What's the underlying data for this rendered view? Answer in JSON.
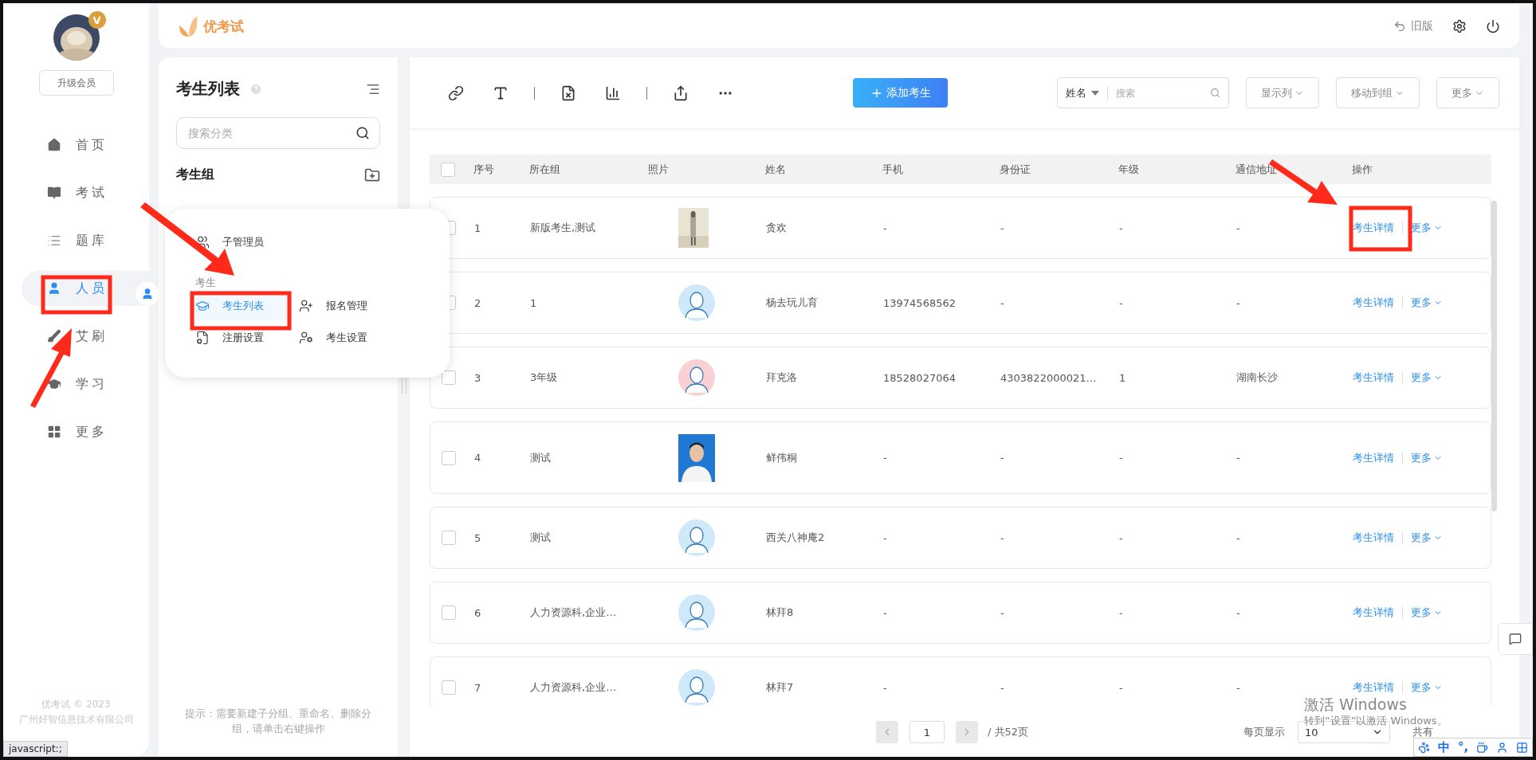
{
  "sidebar": {
    "badge": "V",
    "upgrade": "升级会员",
    "items": [
      {
        "label": "首页",
        "kind": "home",
        "selected": false
      },
      {
        "label": "考试",
        "kind": "exam",
        "selected": false
      },
      {
        "label": "题库",
        "kind": "bank",
        "selected": false
      },
      {
        "label": "人员",
        "kind": "people",
        "selected": true
      },
      {
        "label": "艾刷",
        "kind": "brush",
        "selected": false
      },
      {
        "label": "学习",
        "kind": "study",
        "selected": false
      },
      {
        "label": "更多",
        "kind": "more",
        "selected": false
      }
    ],
    "footer": [
      "优考试 © 2023",
      "广州好智信息技术有限公司"
    ]
  },
  "status_link": "javascript:;",
  "header": {
    "logo": "优考试",
    "old_version": "旧版"
  },
  "group_panel": {
    "title": "考生列表",
    "search_placeholder": "搜索分类",
    "section": "考生组",
    "hint": "提示：需要新建子分组、重命名、删除分组，请单击右键操作"
  },
  "popup": {
    "admin": {
      "label": "子管理员",
      "kind": "admin",
      "selected": false
    },
    "section": "考生",
    "items": [
      {
        "label": "考生列表",
        "kind": "list",
        "selected": true
      },
      {
        "label": "报名管理",
        "kind": "signup",
        "selected": false
      },
      {
        "label": "注册设置",
        "kind": "register",
        "selected": false
      },
      {
        "label": "考生设置",
        "kind": "settings",
        "selected": false
      }
    ]
  },
  "toolbar": {
    "add": "添加考生",
    "field": "姓名",
    "search_placeholder": "搜索",
    "buttons": [
      "显示列",
      "移动到组",
      "更多"
    ]
  },
  "table": {
    "header_checked": false,
    "columns": [
      "序号",
      "所在组",
      "照片",
      "姓名",
      "手机",
      "身份证",
      "年级",
      "通信地址",
      "操作"
    ],
    "rows": [
      {
        "checked": false,
        "index": "1",
        "group": "新版考生,测试",
        "name": "贪欢",
        "phone": "-",
        "id_card": "-",
        "grade": "-",
        "address": "-",
        "detail": "考生详情",
        "more": "更多"
      },
      {
        "checked": false,
        "index": "2",
        "group": "1",
        "photo": {
          "kind": "avatar",
          "color": "#cfe9fb"
        },
        "name": "杨去玩儿育",
        "phone": "13974568562",
        "id_card": "-",
        "grade": "-",
        "address": "-",
        "detail": "考生详情",
        "more": "更多"
      },
      {
        "checked": false,
        "index": "3",
        "group": "3年级",
        "photo": {
          "kind": "avatar",
          "color": "#f9d0d3"
        },
        "name": "拜克洛",
        "phone": "18528027064",
        "id_card": "4303822000021…",
        "grade": "1",
        "address": "湖南长沙",
        "detail": "考生详情",
        "more": "更多"
      },
      {
        "checked": false,
        "index": "4",
        "group": "测试",
        "photo": {
          "kind": "portrait"
        },
        "name": "鲜伟桐",
        "phone": "-",
        "id_card": "-",
        "grade": "-",
        "address": "-",
        "detail": "考生详情",
        "more": "更多"
      },
      {
        "checked": false,
        "index": "5",
        "group": "测试",
        "photo": {
          "kind": "avatar",
          "color": "#cfe9fb"
        },
        "name": "西关八神庵2",
        "phone": "-",
        "id_card": "-",
        "grade": "-",
        "address": "-",
        "detail": "考生详情",
        "more": "更多"
      },
      {
        "checked": false,
        "index": "6",
        "group": "人力资源科,企业…",
        "photo": {
          "kind": "avatar",
          "color": "#cfe9fb"
        },
        "name": "林拜8",
        "phone": "-",
        "id_card": "-",
        "grade": "-",
        "address": "-",
        "detail": "考生详情",
        "more": "更多"
      },
      {
        "checked": false,
        "index": "7",
        "group": "人力资源科,企业…",
        "photo": {
          "kind": "avatar",
          "color": "#cfe9fb"
        },
        "name": "林拜7",
        "phone": "-",
        "id_card": "-",
        "grade": "-",
        "address": "-",
        "detail": "考生详情",
        "more": "更多"
      }
    ]
  },
  "pagination": {
    "page": "1",
    "total_pages": "/ 共52页",
    "per_page_label": "每页显示",
    "per_page": "10",
    "total": "共有"
  },
  "os": {
    "watermark_title": "激活 Windows",
    "watermark_text": "转到“设置”以激活 Windows。",
    "ime": [
      "中",
      "°,"
    ]
  }
}
